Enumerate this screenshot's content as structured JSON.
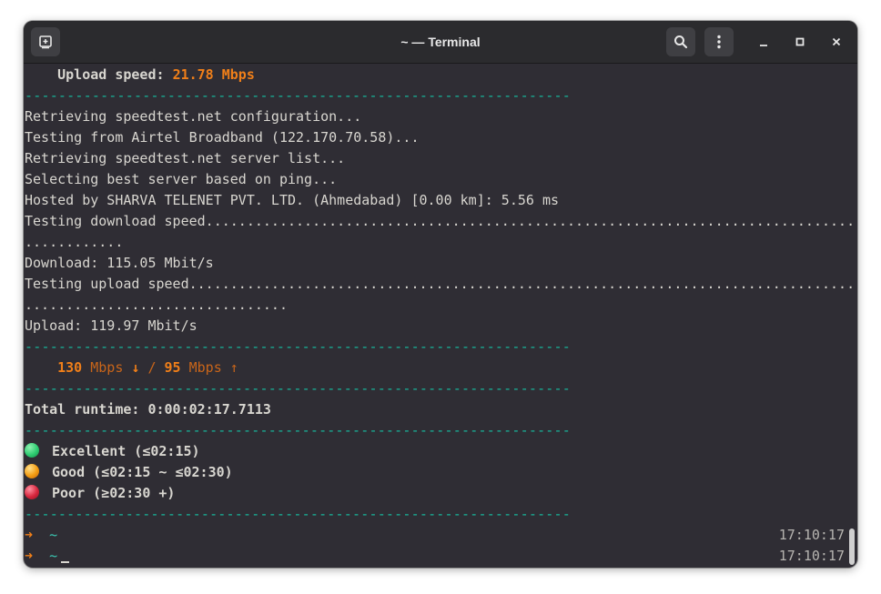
{
  "window": {
    "title": "~ — Terminal"
  },
  "icons": {
    "new_tab": "new-tab-icon",
    "search": "search-icon",
    "menu": "kebab-menu-icon",
    "minimize": "minimize-icon",
    "maximize": "maximize-icon",
    "close": "close-icon"
  },
  "colors": {
    "accent_orange": "#f07f19",
    "teal": "#17b89c",
    "excellent": "#2ecc71",
    "good": "#f39c12",
    "poor": "#d7263d",
    "background": "#2f2d34"
  },
  "terminal": {
    "upload_header": {
      "label": "Upload speed: ",
      "value": "21.78 Mbps"
    },
    "divider": "-----------------------------------------------------------------",
    "lines": [
      "Retrieving speedtest.net configuration...",
      "Testing from Airtel Broadband (122.170.70.58)...",
      "Retrieving speedtest.net server list...",
      "Selecting best server based on ping...",
      "Hosted by SHARVA TELENET PVT. LTD. (Ahmedabad) [0.00 km]: 5.56 ms",
      "Testing download speed..........................................................................................",
      "............",
      "Download: 115.05 Mbit/s",
      "Testing upload speed............................................................................................",
      "................................",
      "Upload: 119.97 Mbit/s"
    ],
    "summary": {
      "down_value": "130",
      "down_unit": "Mbps",
      "down_arrow": "↓",
      "separator": "/",
      "up_value": "95",
      "up_unit": "Mbps",
      "up_arrow": "↑"
    },
    "runtime": "Total runtime: 0:00:02:17.7113",
    "legend": [
      {
        "label": "Excellent (≤02:15)"
      },
      {
        "label": "Good (≤02:15 ~ ≤02:30)"
      },
      {
        "label": "Poor (≥02:30 +)"
      }
    ],
    "prompts": [
      {
        "arrow": "➜",
        "dir": "~",
        "time": "17:10:17"
      },
      {
        "arrow": "➜",
        "dir": "~",
        "time": "17:10:17"
      }
    ]
  }
}
